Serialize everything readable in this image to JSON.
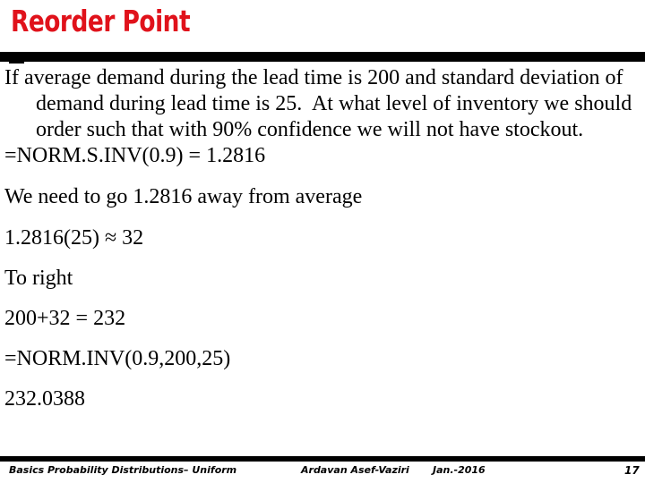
{
  "slide": {
    "title": "Reorder Point",
    "title_color": "#E0121B",
    "background_color": "#FFFFFF",
    "rule_color": "#000000"
  },
  "body": {
    "paragraphs": [
      "If average demand during the lead time is 200 and standard deviation of demand during lead time is 25.  At what level of inventory we should order such that with 90% confidence we will not have stockout.",
      "=NORM.S.INV(0.9) = 1.2816",
      "We need to go 1.2816 away from average",
      "1.2816(25) ≈ 32",
      "To right",
      "200+32 = 232",
      "=NORM.INV(0.9,200,25)",
      "232.0388"
    ]
  },
  "footer": {
    "left_label": "Basics Probability Distributions– Uniform",
    "author": "Ardavan Asef-Vaziri",
    "date": "Jan.-2016",
    "page_number": "17"
  }
}
